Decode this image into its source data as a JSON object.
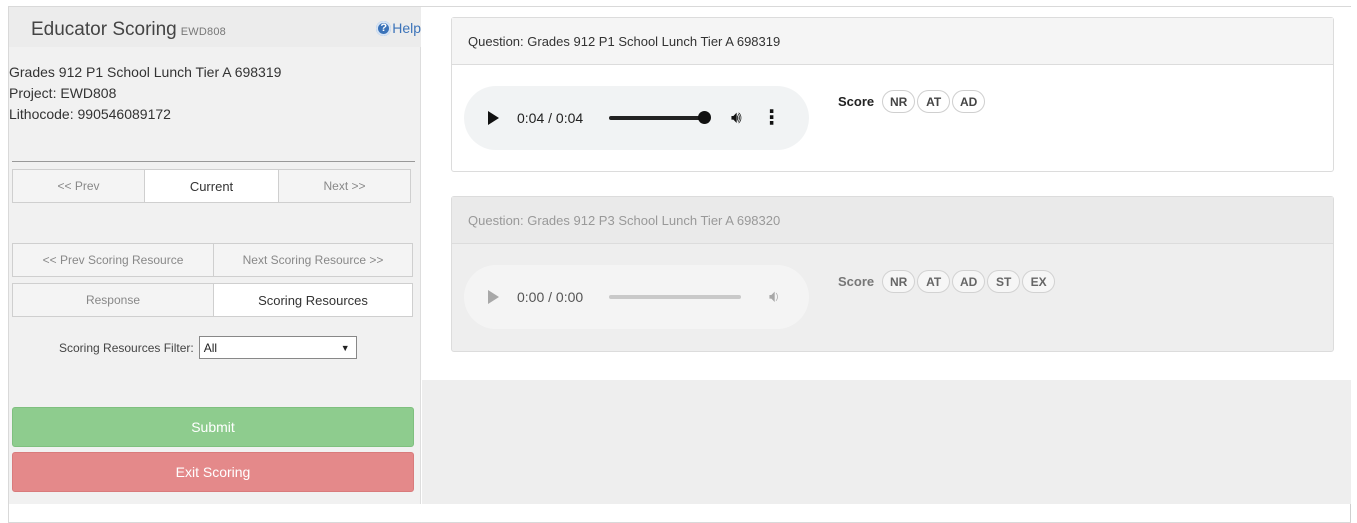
{
  "header": {
    "title": "Educator Scoring",
    "code": "EWD808",
    "help_label": "Help",
    "help_icon": "question-circle-icon"
  },
  "info": {
    "item": "Grades 912 P1 School Lunch Tier A 698319",
    "project": "Project: EWD808",
    "lithocode": "Lithocode: 990546089172"
  },
  "nav": {
    "prev": "<< Prev",
    "current": "Current",
    "next": "Next >>",
    "prev_resource": "<< Prev Scoring Resource",
    "next_resource": "Next Scoring Resource >>",
    "response": "Response",
    "scoring_resources": "Scoring Resources"
  },
  "filter": {
    "label": "Scoring Resources Filter:",
    "selected": "All"
  },
  "actions": {
    "submit": "Submit",
    "exit": "Exit Scoring",
    "submit_color": "#8ecc8e",
    "exit_color": "#e4898a"
  },
  "questions": [
    {
      "title": "Question: Grades 912 P1 School Lunch Tier A 698319",
      "time": "0:04 / 0:04",
      "progress": 1.0,
      "score_label": "Score",
      "options": [
        "NR",
        "AT",
        "AD"
      ]
    },
    {
      "title": "Question: Grades 912 P3 School Lunch Tier A 698320",
      "time": "0:00 / 0:00",
      "progress": 0.0,
      "score_label": "Score",
      "options": [
        "NR",
        "AT",
        "AD",
        "ST",
        "EX"
      ]
    }
  ]
}
